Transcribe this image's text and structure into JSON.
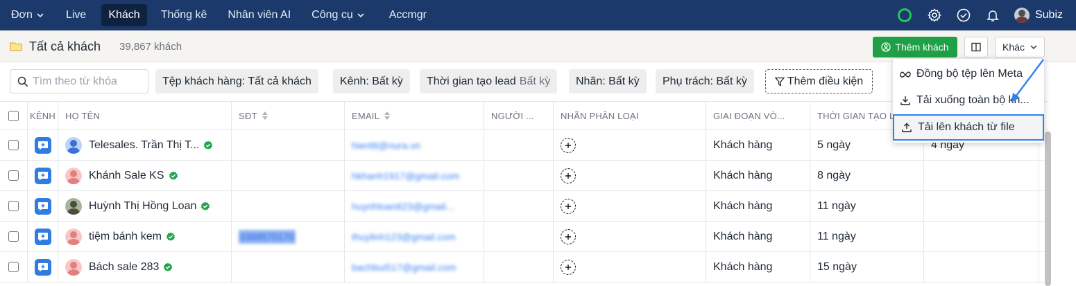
{
  "nav": {
    "items": [
      {
        "label": "Đơn",
        "caret": true,
        "active": false
      },
      {
        "label": "Live",
        "caret": false,
        "active": false
      },
      {
        "label": "Khách",
        "caret": false,
        "active": true
      },
      {
        "label": "Thống kê",
        "caret": false,
        "active": false
      },
      {
        "label": "Nhân viên AI",
        "caret": false,
        "active": false
      },
      {
        "label": "Công cụ",
        "caret": true,
        "active": false
      },
      {
        "label": "Accmgr",
        "caret": false,
        "active": false
      }
    ],
    "user_name": "Subiz",
    "status_color": "#22c55e",
    "bg_color": "#1b3a6b"
  },
  "header": {
    "title": "Tất cả khách",
    "count": "39,867 khách",
    "add_button": "Thêm khách",
    "more_button": "Khác",
    "add_color": "#1fa046"
  },
  "filters": {
    "search_placeholder": "Tìm theo từ khóa",
    "chips": [
      {
        "label": "Tệp khách hàng: Tất cả khách",
        "muted": ""
      },
      {
        "label": "Kênh: Bất kỳ",
        "muted": ""
      },
      {
        "label": "Thời gian tạo lead",
        "muted": "Bất kỳ"
      },
      {
        "label": "Nhãn: Bất kỳ",
        "muted": ""
      },
      {
        "label": "Phụ trách: Bất kỳ",
        "muted": ""
      }
    ],
    "add_condition": "Thêm điều kiện"
  },
  "table": {
    "columns": [
      "KÊNH",
      "HỌ TÊN",
      "SĐT",
      "EMAIL",
      "NGƯỜI ...",
      "NHÃN PHÂN LOẠI",
      "GIAI ĐOẠN VÒ...",
      "THỜI GIAN TẠO L",
      ""
    ],
    "rows": [
      {
        "name": "Telesales. Trần Thị T...",
        "phone": "",
        "email": "hienttt@nura.vn",
        "owner": "",
        "stage": "Khách hàng",
        "created": "5 ngày",
        "last": "4 ngày",
        "avatar": "blue"
      },
      {
        "name": "Khánh Sale KS",
        "phone": "",
        "email": "hkhanh1917@gmail.com",
        "owner": "",
        "stage": "Khách hàng",
        "created": "8 ngày",
        "last": "",
        "avatar": "pink"
      },
      {
        "name": "Huỳnh Thị Hồng Loan",
        "phone": "",
        "email": "huynhloan623@gmail...",
        "owner": "",
        "stage": "Khách hàng",
        "created": "11 ngày",
        "last": "",
        "avatar": "photo"
      },
      {
        "name": "tiệm bánh kem",
        "phone": "0399570170",
        "email": "thuylinh123@gmail.com",
        "owner": "",
        "stage": "Khách hàng",
        "created": "11 ngày",
        "last": "",
        "avatar": "pink"
      },
      {
        "name": "Bách sale 283",
        "phone": "",
        "email": "bachbui517@gmail.com",
        "owner": "",
        "stage": "Khách hàng",
        "created": "15 ngày",
        "last": "",
        "avatar": "pink"
      }
    ]
  },
  "menu": {
    "items": [
      {
        "label": "Đồng bộ tệp lên Meta",
        "icon": "meta-icon"
      },
      {
        "label": "Tải xuống toàn bộ kh...",
        "icon": "download-icon"
      },
      {
        "label": "Tải lên khách từ file",
        "icon": "upload-icon",
        "highlighted": true
      }
    ],
    "highlight_color": "#2f80ed"
  }
}
